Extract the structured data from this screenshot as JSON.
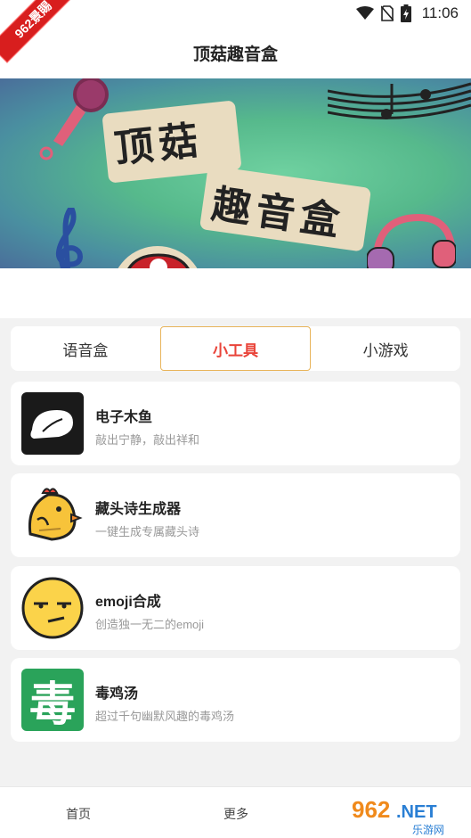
{
  "status": {
    "badge": "962景賜",
    "time": "11:06"
  },
  "header": {
    "title": "顶菇趣音盒"
  },
  "banner": {
    "line1": "顶菇",
    "line2": "趣音盒"
  },
  "tabs": [
    {
      "label": "语音盒",
      "active": false
    },
    {
      "label": "小工具",
      "active": true
    },
    {
      "label": "小游戏",
      "active": false
    }
  ],
  "tools": [
    {
      "title": "电子木鱼",
      "desc": "敲出宁静，敲出祥和",
      "icon": "wooden-fish-icon"
    },
    {
      "title": "藏头诗生成器",
      "desc": "一键生成专属藏头诗",
      "icon": "chick-icon"
    },
    {
      "title": "emoji合成",
      "desc": "创造独一无二的emoji",
      "icon": "emoji-face-icon"
    },
    {
      "title": "毒鸡汤",
      "desc": "超过千句幽默风趣的毒鸡汤",
      "icon": "poison-char-icon",
      "icon_char": "毒"
    }
  ],
  "bottom_nav": {
    "home": "首页",
    "more": "更多"
  },
  "watermark": {
    "brand": "962.NET",
    "sub": "乐游网"
  },
  "colors": {
    "accent": "#e9443a",
    "tab_border": "#e8b45a",
    "badge_red": "#d81e1e",
    "poison_green": "#2aa35a"
  }
}
